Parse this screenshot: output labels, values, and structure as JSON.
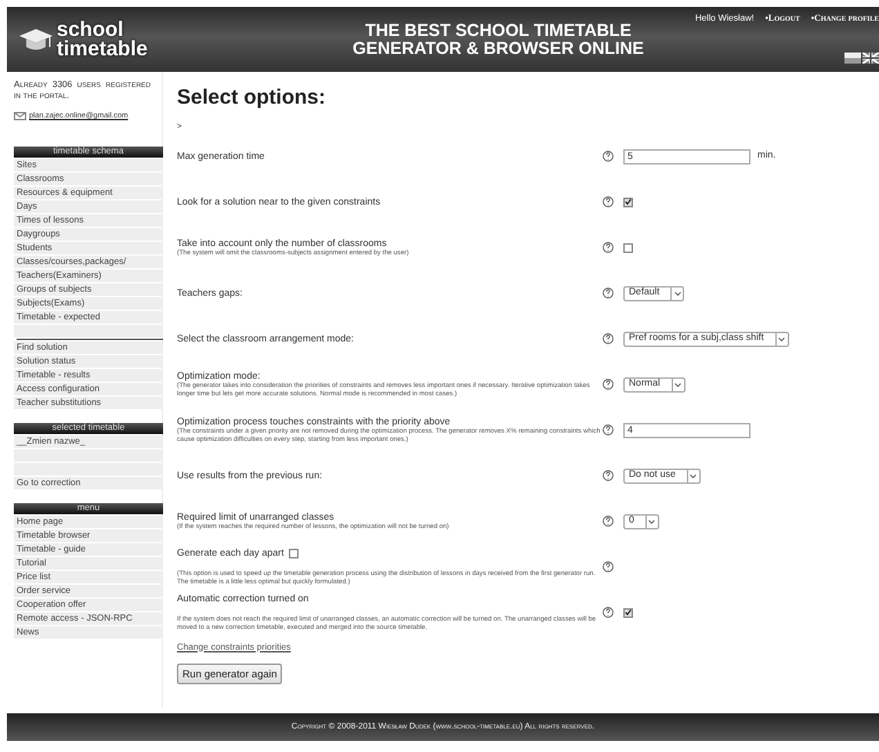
{
  "header": {
    "logo_top": "school",
    "logo_bottom": "timetable",
    "title_lines": [
      "THE BEST SCHOOL TIMETABLE",
      "GENERATOR & BROWSER ONLINE"
    ],
    "greeting": "Hello Wiesław!",
    "links": [
      "•Logout",
      "•Change profile"
    ]
  },
  "sidebar": {
    "users_notice": "Already 3306 users registered in the portal.",
    "email": "plan.zajec.online@gmail.com",
    "sections": [
      {
        "title": "timetable schema",
        "items": [
          {
            "kind": "link",
            "label": "Sites"
          },
          {
            "kind": "link",
            "label": "Classrooms"
          },
          {
            "kind": "link",
            "label": "Resources & equipment"
          },
          {
            "kind": "link",
            "label": "Days"
          },
          {
            "kind": "link",
            "label": "Times of lessons"
          },
          {
            "kind": "link",
            "label": "Daygroups"
          },
          {
            "kind": "link",
            "label": "Students"
          },
          {
            "kind": "link",
            "label": "Classes/courses,packages/"
          },
          {
            "kind": "link",
            "label": "Teachers(Examiners)"
          },
          {
            "kind": "link",
            "label": "Groups of subjects"
          },
          {
            "kind": "link",
            "label": "Subjects(Exams)"
          },
          {
            "kind": "link",
            "label": "Timetable - expected"
          },
          {
            "kind": "blank"
          },
          {
            "kind": "divider"
          },
          {
            "kind": "link",
            "label": "Find solution"
          },
          {
            "kind": "link",
            "label": "Solution status"
          },
          {
            "kind": "link",
            "label": "Timetable - results"
          },
          {
            "kind": "link",
            "label": "Access configuration"
          },
          {
            "kind": "link",
            "label": "Teacher substitutions"
          }
        ]
      },
      {
        "title": "selected timetable",
        "items": [
          {
            "kind": "link",
            "label": "__Zmien nazwe_"
          },
          {
            "kind": "blank"
          },
          {
            "kind": "blank"
          },
          {
            "kind": "link",
            "label": "Go to correction"
          }
        ]
      },
      {
        "title": "menu",
        "items": [
          {
            "kind": "link",
            "label": "Home page"
          },
          {
            "kind": "link",
            "label": "Timetable browser"
          },
          {
            "kind": "link",
            "label": "Timetable - guide"
          },
          {
            "kind": "link",
            "label": "Tutorial"
          },
          {
            "kind": "link",
            "label": "Price list"
          },
          {
            "kind": "link",
            "label": "Order service"
          },
          {
            "kind": "link",
            "label": "Cooperation offer"
          },
          {
            "kind": "link",
            "label": "Remote access - JSON-RPC"
          },
          {
            "kind": "link",
            "label": "News"
          }
        ]
      }
    ]
  },
  "main": {
    "title": "Select options:",
    "breadcrumb": ">",
    "options": [
      {
        "kind": "text",
        "label": "Max generation time",
        "value": "5",
        "unit": "min."
      },
      {
        "kind": "checkbox",
        "label": "Look for a solution near to the given constraints",
        "checked": true
      },
      {
        "kind": "checkbox",
        "label": "Take into account only the number of classrooms",
        "note": "(The system will omit the classrooms-subjects assignment entered by the user)",
        "checked": false
      },
      {
        "kind": "select",
        "label": "Teachers gaps:",
        "value": "Default"
      },
      {
        "kind": "select",
        "label": "Select the classroom arrangement mode:",
        "value": "Pref rooms for a subj,class shift"
      },
      {
        "kind": "select",
        "label": "Optimization mode:",
        "note": "(The generator takes into consideration the priorities of constraints and removes less important ones if necessary. Iterative optimization takes longer time but lets get more accurate solutions. Normal mode is recommended in most cases.)",
        "value": "Normal"
      },
      {
        "kind": "text",
        "label": "Optimization process touches constraints with the priority above",
        "note": "(The constraints under a given priority are not removed during the optimization process. The generator removes X% remaining constraints which cause optimization difficulties on every step, starting from less important ones.)",
        "value": "4"
      },
      {
        "kind": "select",
        "label": "Use results from the previous run:",
        "value": "Do not use"
      },
      {
        "kind": "select",
        "label": "Required limit of unarranged classes",
        "note": "(If the system reaches the required number of lessons, the optimization will not be turned on)",
        "value": "0"
      },
      {
        "kind": "inline_checkbox",
        "label": "Generate each day apart",
        "note": "(This option is used to speed up the timetable generation process using the distribution of lessons in days received from the first generator run. The timetable is a little less optimal but quickly formulated.)",
        "checked": false
      },
      {
        "kind": "checkbox",
        "label": "Automatic correction turned on",
        "note": "If the system does not reach the required limit of unarranged classes, an automatic correction will be turned on. The unarranged classes will be moved to a new correction timetable, executed and merged into the source timetable.",
        "checked": true
      }
    ],
    "link": "Change constraints priorities",
    "button": "Run generator again"
  },
  "footer": "Copyright © 2008-2011 Wiesław Dudek (www.school-timetable.eu) All rights reserved."
}
